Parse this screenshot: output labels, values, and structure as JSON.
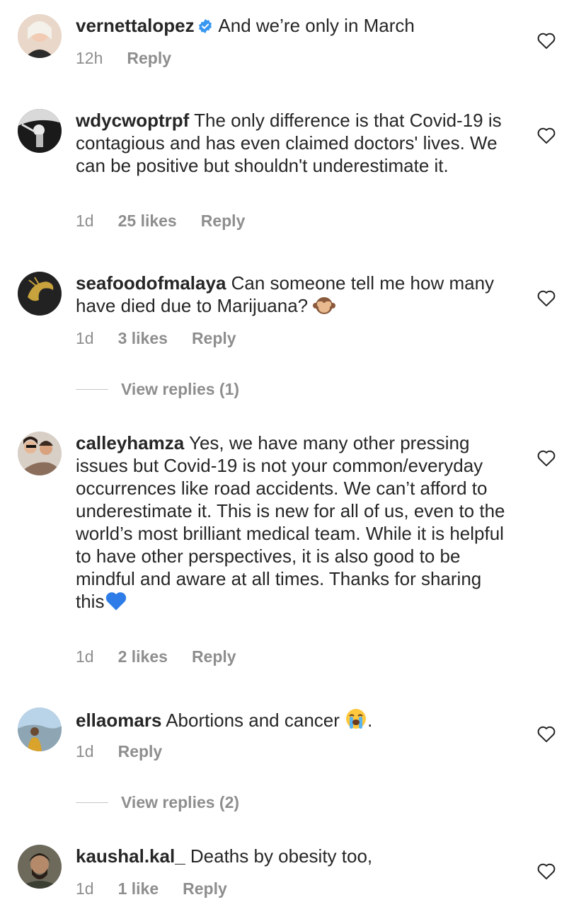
{
  "comments": [
    {
      "username": "vernettalopez",
      "verified": true,
      "text": "And we’re only in March",
      "time": "12h",
      "likes": "",
      "reply_label": "Reply"
    },
    {
      "username": "wdycwoptrpf",
      "verified": false,
      "text": "The only difference is that Covid-19 is contagious and has even claimed doctors' lives. We can be positive but shouldn't underestimate it.",
      "time": "1d",
      "likes": "25 likes",
      "reply_label": "Reply"
    },
    {
      "username": "seafoodofmalaya",
      "verified": false,
      "text": "Can someone tell me how many have died due to Marijuana?",
      "emoji": "see-no-evil-monkey",
      "time": "1d",
      "likes": "3 likes",
      "reply_label": "Reply",
      "view_replies": "View replies (1)"
    },
    {
      "username": "calleyhamza",
      "verified": false,
      "text": "Yes, we have many other pressing issues but Covid-19 is not your common/everyday occurrences like road accidents. We can’t afford to underestimate it. This is new for all of us, even to the world’s most brilliant medical team. While it is helpful to have other perspectives, it is also good to be mindful and aware at all times. Thanks for sharing this",
      "emoji": "blue-heart",
      "time": "1d",
      "likes": "2 likes",
      "reply_label": "Reply"
    },
    {
      "username": "ellaomars",
      "verified": false,
      "text": "Abortions and cancer",
      "emoji": "loudly-crying-face",
      "text_after": ".",
      "time": "1d",
      "likes": "",
      "reply_label": "Reply",
      "view_replies": "View replies (2)"
    },
    {
      "username": "kaushal.kal_",
      "verified": false,
      "text": "Deaths by obesity too,",
      "time": "1d",
      "likes": "1 like",
      "reply_label": "Reply"
    }
  ],
  "colors": {
    "text": "#262626",
    "secondary": "#8e8e8e",
    "verified_blue": "#3897f0"
  }
}
